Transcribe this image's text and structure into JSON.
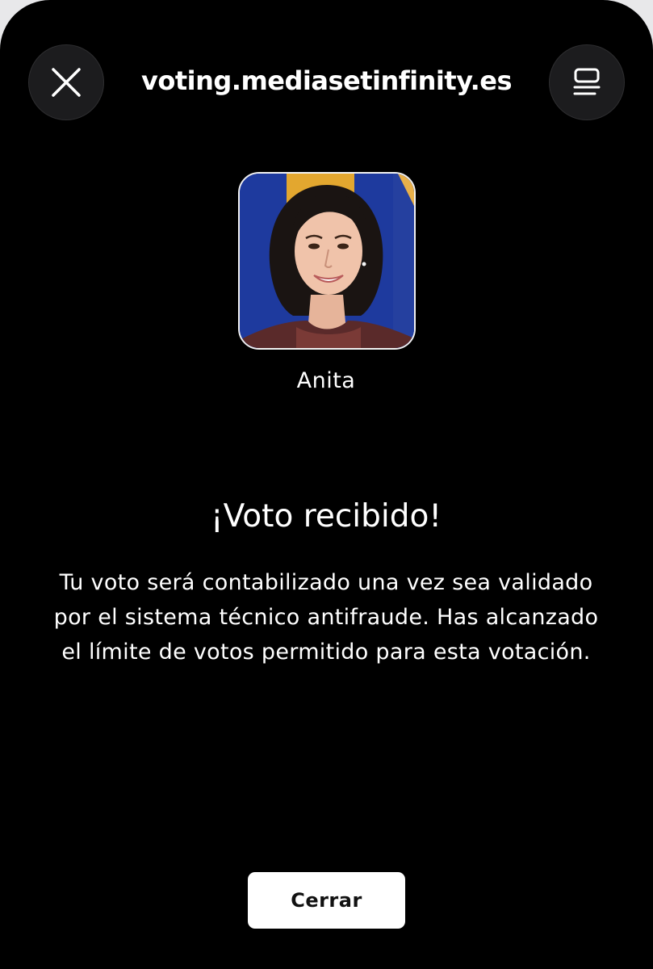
{
  "browser": {
    "url": "voting.mediasetinfinity.es",
    "close_icon": "close-icon",
    "tabs_icon": "tabs-icon"
  },
  "candidate": {
    "name": "Anita",
    "photo": "candidate-photo"
  },
  "confirmation": {
    "title": "¡Voto recibido!",
    "message": "Tu voto será contabilizado una vez sea validado por el sistema técnico antifraude. Has alcanzado el límite de votos permitido para esta votación."
  },
  "actions": {
    "close_label": "Cerrar"
  },
  "colors": {
    "background": "#000000",
    "text": "#ffffff",
    "button_background": "#ffffff",
    "button_text": "#111111",
    "chrome_button": "#1c1c1e"
  }
}
